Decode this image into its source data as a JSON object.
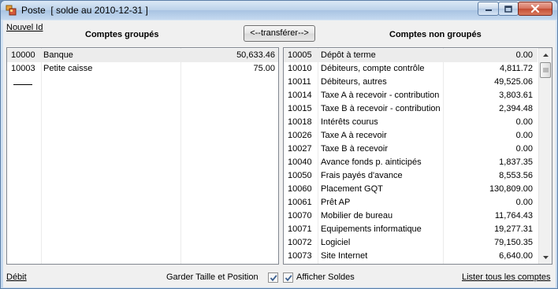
{
  "window": {
    "title": "Poste  [ solde au 2010-12-31 ]"
  },
  "toolbar": {
    "new_id_link": "Nouvel Id",
    "grouped_header": "Comptes groupés",
    "transfer_button": "<--transférer-->",
    "ungrouped_header": "Comptes non groupés"
  },
  "grouped_accounts": [
    {
      "id": "10000",
      "name": "Banque",
      "amount": "50,633.46"
    },
    {
      "id": "10003",
      "name": "Petite caisse",
      "amount": "75.00"
    }
  ],
  "ungrouped_accounts": [
    {
      "id": "10005",
      "name": "Dépôt à terme",
      "amount": "0.00"
    },
    {
      "id": "10010",
      "name": "Débiteurs, compte contrôle",
      "amount": "4,811.72"
    },
    {
      "id": "10011",
      "name": "Débiteurs, autres",
      "amount": "49,525.06"
    },
    {
      "id": "10014",
      "name": "Taxe A à recevoir - contribution",
      "amount": "3,803.61"
    },
    {
      "id": "10015",
      "name": "Taxe B à recevoir - contribution",
      "amount": "2,394.48"
    },
    {
      "id": "10018",
      "name": "Intérêts courus",
      "amount": "0.00"
    },
    {
      "id": "10026",
      "name": "Taxe A à recevoir",
      "amount": "0.00"
    },
    {
      "id": "10027",
      "name": "Taxe B à recevoir",
      "amount": "0.00"
    },
    {
      "id": "10040",
      "name": "Avance fonds p. ainticipés",
      "amount": "1,837.35"
    },
    {
      "id": "10050",
      "name": "Frais payés d'avance",
      "amount": "8,553.56"
    },
    {
      "id": "10060",
      "name": "Placement GQT",
      "amount": "130,809.00"
    },
    {
      "id": "10061",
      "name": "Prêt AP",
      "amount": "0.00"
    },
    {
      "id": "10070",
      "name": "Mobilier de bureau",
      "amount": "11,764.43"
    },
    {
      "id": "10071",
      "name": "Equipements informatique",
      "amount": "19,277.31"
    },
    {
      "id": "10072",
      "name": "Logiciel",
      "amount": "79,150.35"
    },
    {
      "id": "10073",
      "name": "Site Internet",
      "amount": "6,640.00"
    }
  ],
  "footer": {
    "debit_link": "Débit",
    "keep_size_label": "Garder Taille et Position",
    "keep_size_checked": true,
    "show_balances_label": "Afficher Soldes",
    "show_balances_checked": true,
    "list_all_link": "Lister tous les comptes"
  },
  "icons": {
    "app": "window-app-icon",
    "minimize": "minimize-icon",
    "maximize": "maximize-icon",
    "close": "close-icon",
    "scroll_up": "scroll-up-arrow-icon",
    "scroll_down": "scroll-down-arrow-icon",
    "check": "checkmark-icon"
  },
  "colors": {
    "title_gradient_top": "#dbe8f5",
    "close_button": "#c44d34",
    "list_background": "#ffffff",
    "client_background": "#f0f0f0"
  }
}
